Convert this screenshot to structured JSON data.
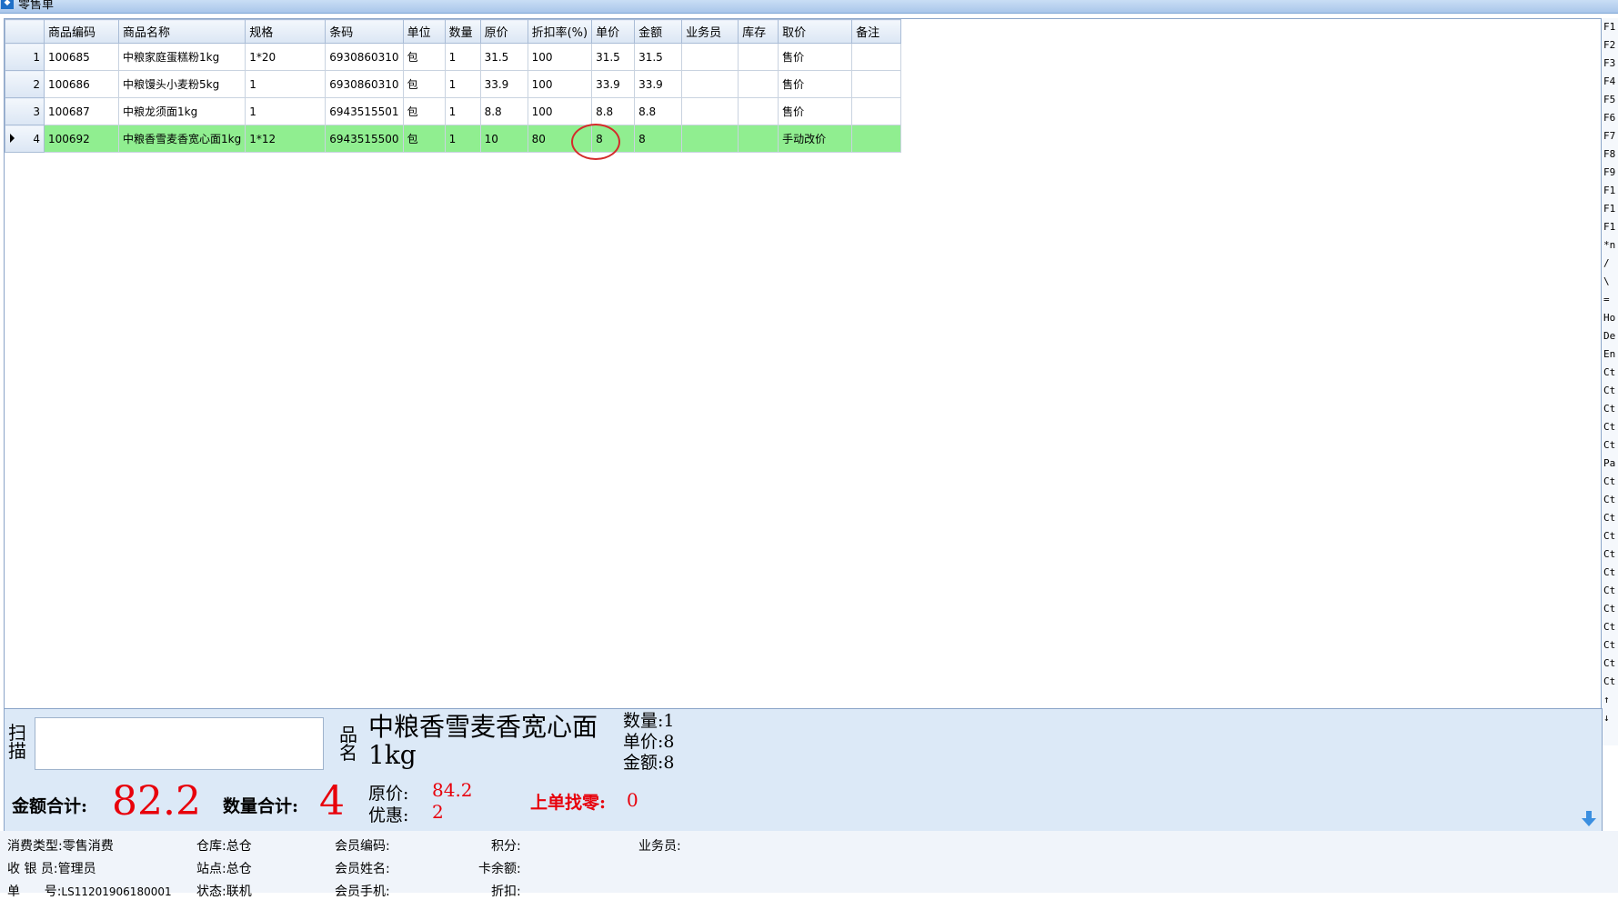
{
  "window": {
    "title": "零售单",
    "icon": "app-icon"
  },
  "grid": {
    "columns": [
      "商品编码",
      "商品名称",
      "规格",
      "条码",
      "单位",
      "数量",
      "原价",
      "折扣率(%)",
      "单价",
      "金额",
      "业务员",
      "库存",
      "取价",
      "备注"
    ],
    "rows": [
      {
        "num": "1",
        "code": "100685",
        "name": "中粮家庭蛋糕粉1kg",
        "spec": "1*20",
        "barcode": "6930860310",
        "unit": "包",
        "qty": "1",
        "orig_price": "31.5",
        "discount": "100",
        "unit_price": "31.5",
        "amount": "31.5",
        "salesman": "",
        "stock": "",
        "price_source": "售价",
        "remark": ""
      },
      {
        "num": "2",
        "code": "100686",
        "name": "中粮馒头小麦粉5kg",
        "spec": "1",
        "barcode": "6930860310",
        "unit": "包",
        "qty": "1",
        "orig_price": "33.9",
        "discount": "100",
        "unit_price": "33.9",
        "amount": "33.9",
        "salesman": "",
        "stock": "",
        "price_source": "售价",
        "remark": ""
      },
      {
        "num": "3",
        "code": "100687",
        "name": "中粮龙须面1kg",
        "spec": "1",
        "barcode": "6943515501",
        "unit": "包",
        "qty": "1",
        "orig_price": "8.8",
        "discount": "100",
        "unit_price": "8.8",
        "amount": "8.8",
        "salesman": "",
        "stock": "",
        "price_source": "售价",
        "remark": ""
      },
      {
        "num": "4",
        "code": "100692",
        "name": "中粮香雪麦香宽心面1kg",
        "spec": "1*12",
        "barcode": "6943515500",
        "unit": "包",
        "qty": "1",
        "orig_price": "10",
        "discount": "80",
        "unit_price": "8",
        "amount": "8",
        "salesman": "",
        "stock": "",
        "price_source": "手动改价",
        "remark": ""
      }
    ],
    "selected_row": 4,
    "selected_color": "#90ee90",
    "highlight_color": "#d42b2b"
  },
  "hotkeys": [
    "F1",
    "F2",
    "F3",
    "F4",
    "F5",
    "F6",
    "F7",
    "F8",
    "F9",
    "F1",
    "F1",
    "F1",
    "*n",
    "/",
    "\\",
    "=",
    "Ho",
    "De",
    "En",
    "Ct",
    "Ct",
    "Ct",
    "Ct",
    "Ct",
    "Pa",
    "Ct",
    "Ct",
    "Ct",
    "Ct",
    "Ct",
    "Ct",
    "Ct",
    "Ct",
    "Ct",
    "Ct",
    "Ct",
    "Ct",
    "↑",
    "↓"
  ],
  "scan": {
    "label": "扫描",
    "input_value": "",
    "name_label": "品名",
    "product_name": "中粮香雪麦香宽心面1kg",
    "qty_label": "数量:",
    "qty_value": "1",
    "price_label": "单价:",
    "price_value": "8",
    "amount_label": "金额:",
    "amount_value": "8"
  },
  "totals": {
    "amount_label": "金额合计:",
    "amount_value": "82.2",
    "qty_label": "数量合计:",
    "qty_value": "4",
    "orig_label": "原价:",
    "orig_value": "84.2",
    "discount_label": "优惠:",
    "discount_value": "2",
    "change_label": "上单找零:",
    "change_value": "0",
    "accent": "#e8000b"
  },
  "status": {
    "type_label": "消费类型:",
    "type_value": "零售消费",
    "warehouse_label": "仓库:",
    "warehouse_value": "总仓",
    "member_code_label": "会员编码:",
    "member_code_value": "",
    "points_label": "积分:",
    "points_value": "",
    "salesman_label": "业务员:",
    "salesman_value": "",
    "cashier_label": "收 银 员:",
    "cashier_value": "管理员",
    "station_label": "站点:",
    "station_value": "总仓",
    "member_name_label": "会员姓名:",
    "member_name_value": "",
    "card_balance_label": "卡余额:",
    "card_balance_value": "",
    "order_label": "单      号:",
    "order_value": "LS11201906180001",
    "state_label": "状态:",
    "state_value": "联机",
    "member_phone_label": "会员手机:",
    "member_phone_value": "",
    "discount_label": "折扣:",
    "discount_value": ""
  }
}
